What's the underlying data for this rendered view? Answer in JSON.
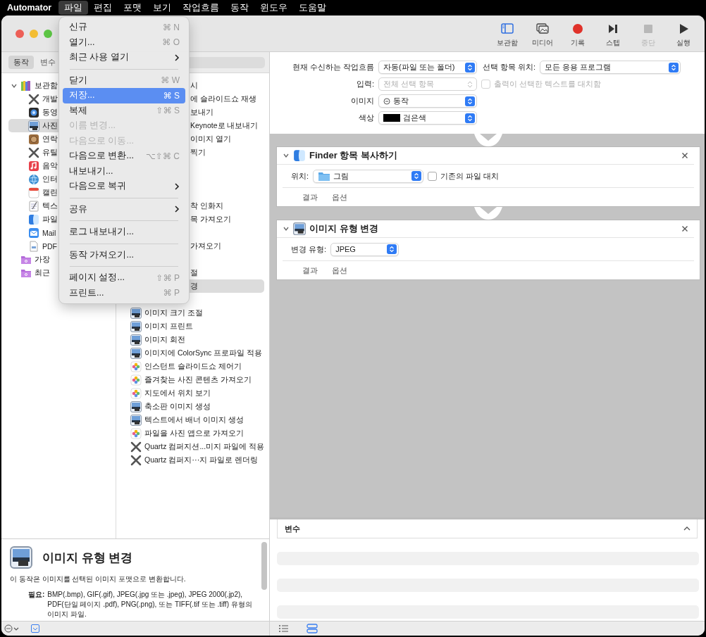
{
  "menu_bar": {
    "app_name": "Automator",
    "items": [
      {
        "label": "파일",
        "selected": true
      },
      {
        "label": "편집",
        "selected": false
      },
      {
        "label": "포맷",
        "selected": false
      },
      {
        "label": "보기",
        "selected": false
      },
      {
        "label": "작업흐름",
        "selected": false
      },
      {
        "label": "동작",
        "selected": false
      },
      {
        "label": "윈도우",
        "selected": false
      },
      {
        "label": "도움말",
        "selected": false
      }
    ]
  },
  "toolbar": {
    "buttons": [
      {
        "label": "보관함",
        "kind": "library",
        "disabled": false
      },
      {
        "label": "미디어",
        "kind": "media",
        "disabled": false
      },
      {
        "label": "기록",
        "kind": "record",
        "disabled": false
      },
      {
        "label": "스텝",
        "kind": "step",
        "disabled": false
      },
      {
        "label": "중단",
        "kind": "stop",
        "disabled": true
      },
      {
        "label": "실행",
        "kind": "run",
        "disabled": false
      }
    ]
  },
  "sidebar_tabs": [
    {
      "label": "동작",
      "selected": true
    },
    {
      "label": "변수",
      "selected": false
    }
  ],
  "library": {
    "items": [
      {
        "label": "보관함",
        "kind": "library",
        "expanded": true,
        "selected": false,
        "children": [
          {
            "label": "개발",
            "kind": "tools",
            "selected": false
          },
          {
            "label": "동영",
            "kind": "media",
            "selected": false
          },
          {
            "label": "사진",
            "kind": "preview",
            "selected": true
          },
          {
            "label": "연락",
            "kind": "contacts",
            "selected": false
          },
          {
            "label": "유틸",
            "kind": "tools",
            "selected": false
          },
          {
            "label": "음악",
            "kind": "music",
            "selected": false
          },
          {
            "label": "인터",
            "kind": "globe",
            "selected": false
          },
          {
            "label": "캘린",
            "kind": "calendar",
            "selected": false
          },
          {
            "label": "텍스",
            "kind": "text",
            "selected": false
          },
          {
            "label": "파일",
            "kind": "finder",
            "selected": false
          },
          {
            "label": "Mail",
            "kind": "mail",
            "selected": false
          },
          {
            "label": "PDF",
            "kind": "pdf",
            "selected": false
          }
        ]
      },
      {
        "label": "가장",
        "kind": "folder",
        "selected": false
      },
      {
        "label": "최근",
        "kind": "folder",
        "selected": false
      }
    ]
  },
  "actions": {
    "covered": [
      {
        "text": "시",
        "selected": false
      },
      {
        "text": "에 슬라이드쇼 재생",
        "selected": false
      },
      {
        "text": "보내기",
        "selected": false
      },
      {
        "text": "Keynote로 내보내기",
        "selected": false
      },
      {
        "text": "이미지 열기",
        "selected": false
      },
      {
        "text": "찍기",
        "selected": false
      },
      {
        "text": "착 인화지",
        "selected": false
      },
      {
        "text": "목 가져오기",
        "selected": false
      },
      {
        "text": "가져오기",
        "selected": false
      },
      {
        "text": "절",
        "selected": false
      },
      {
        "text": "경",
        "selected": true
      }
    ],
    "items": [
      {
        "text": "이미지 크기 조절",
        "kind": "preview"
      },
      {
        "text": "이미지 프린트",
        "kind": "preview"
      },
      {
        "text": "이미지 회전",
        "kind": "preview"
      },
      {
        "text": "이미지에 ColorSync 프로파일 적용",
        "kind": "preview"
      },
      {
        "text": "인스턴트 슬라이드쇼 제어기",
        "kind": "photos"
      },
      {
        "text": "즐겨찾는 사진 콘텐츠 가져오기",
        "kind": "photos"
      },
      {
        "text": "지도에서 위치 보기",
        "kind": "photos"
      },
      {
        "text": "축소판 이미지 생성",
        "kind": "preview"
      },
      {
        "text": "텍스트에서 배너 이미지 생성",
        "kind": "preview"
      },
      {
        "text": "파일을 사진 앱으로 가져오기",
        "kind": "photos"
      },
      {
        "text": "Quartz 컴퍼지션...미지 파일에 적용",
        "kind": "tools"
      },
      {
        "text": "Quartz 컴퍼지⋯지 파일로 렌더링",
        "kind": "tools"
      }
    ]
  },
  "description": {
    "title": "이미지 유형 변경",
    "text": "이 동작은 이미지를 선택된 이미지 포맷으로 변환합니다.",
    "requires_label": "필요:",
    "requires": "BMP(.bmp), GIF(.gif), JPEG(.jpg 또는 .jpeg), JPEG 2000(.jp2), PDF(단일 페이지 .pdf), PNG(.png), 또는 TIFF(.tif 또는 .tiff) 유형의 이미지 파일."
  },
  "left_bottom_bar": {
    "description_toggle": {
      "on": true
    }
  },
  "workflow": {
    "settings": {
      "receive": {
        "label": "현재 수신하는 작업흐름",
        "value": "자동(파일 또는 폴더)"
      },
      "location": {
        "label": "선택 항목 위치:",
        "value": "모든 응용 프로그램"
      },
      "input": {
        "label": "입력:",
        "value": "전체 선택 항목",
        "disabled": true
      },
      "replace_output": {
        "label": "출력이 선택한 텍스트를 대치함",
        "checked": false,
        "disabled": true
      },
      "image": {
        "label": "이미지",
        "value": "동작",
        "kind": "action"
      },
      "color": {
        "label": "색상",
        "value": "검은색",
        "kind": "swatch"
      }
    },
    "actions": [
      {
        "title": "Finder 항목 복사하기",
        "kind": "finder",
        "expanded": true,
        "fields": [
          {
            "kind": "folder",
            "label": "위치:",
            "value": "그림"
          },
          {
            "kind": "checkbox",
            "label": "기존의 파일 대치",
            "checked": false
          }
        ],
        "footer": [
          "결과",
          "옵션"
        ]
      },
      {
        "title": "이미지 유형 변경",
        "kind": "preview",
        "expanded": true,
        "fields": [
          {
            "kind": "plain",
            "label": "변경 유형:",
            "value": "JPEG"
          }
        ],
        "footer": [
          "결과",
          "옵션"
        ]
      }
    ]
  },
  "variables": {
    "title": "변수"
  },
  "view_buttons": [
    {
      "kind": "list",
      "selected": false
    },
    {
      "kind": "flow",
      "selected": true
    }
  ],
  "file_menu": {
    "items": [
      {
        "kind": "item",
        "label": "신규",
        "shortcut": "⌘ N",
        "disabled": false,
        "selected": false
      },
      {
        "kind": "item",
        "label": "열기...",
        "shortcut": "⌘ O",
        "disabled": false,
        "selected": false
      },
      {
        "kind": "item",
        "label": "최근 사용 열기",
        "submenu": true,
        "disabled": false,
        "selected": false
      },
      {
        "kind": "separator"
      },
      {
        "kind": "item",
        "label": "닫기",
        "shortcut": "⌘ W",
        "disabled": false,
        "selected": false
      },
      {
        "kind": "item",
        "label": "저장...",
        "shortcut": "⌘ S",
        "disabled": false,
        "selected": true
      },
      {
        "kind": "item",
        "label": "복제",
        "shortcut": "⇧⌘ S",
        "disabled": false,
        "selected": false
      },
      {
        "kind": "item",
        "label": "이름 변경...",
        "disabled": true,
        "selected": false
      },
      {
        "kind": "item",
        "label": "다음으로 이동...",
        "disabled": true,
        "selected": false
      },
      {
        "kind": "item",
        "label": "다음으로 변환...",
        "shortcut": "⌥⇧⌘ C",
        "disabled": false,
        "selected": false
      },
      {
        "kind": "item",
        "label": "내보내기...",
        "disabled": false,
        "selected": false
      },
      {
        "kind": "item",
        "label": "다음으로 복귀",
        "submenu": true,
        "disabled": false,
        "selected": false
      },
      {
        "kind": "separator"
      },
      {
        "kind": "item",
        "label": "공유",
        "submenu": true,
        "disabled": false,
        "selected": false
      },
      {
        "kind": "separator"
      },
      {
        "kind": "item",
        "label": "로그 내보내기...",
        "disabled": false,
        "selected": false
      },
      {
        "kind": "separator"
      },
      {
        "kind": "item",
        "label": "동작 가져오기...",
        "disabled": false,
        "selected": false
      },
      {
        "kind": "separator"
      },
      {
        "kind": "item",
        "label": "페이지 설정...",
        "shortcut": "⇧⌘ P",
        "disabled": false,
        "selected": false
      },
      {
        "kind": "item",
        "label": "프린트...",
        "shortcut": "⌘ P",
        "disabled": false,
        "selected": false
      }
    ]
  }
}
